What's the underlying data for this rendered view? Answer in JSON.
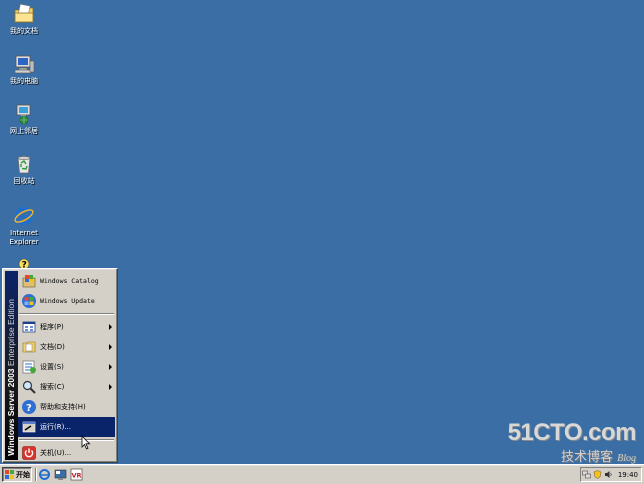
{
  "desktop": {
    "icons": [
      {
        "label": "我的文档",
        "icon": "my-documents-icon"
      },
      {
        "label": "我的电脑",
        "icon": "my-computer-icon"
      },
      {
        "label": "网上邻居",
        "icon": "network-places-icon"
      },
      {
        "label": "回收站",
        "icon": "recycle-bin-icon"
      },
      {
        "label": "Internet Explorer",
        "icon": "internet-explorer-icon"
      }
    ]
  },
  "start_menu": {
    "banner": {
      "brand": "Windows Server",
      "version": "2003",
      "edition": "Enterprise Edition"
    },
    "top_items": [
      {
        "label": "Windows Catalog",
        "icon": "windows-catalog-icon"
      },
      {
        "label": "Windows Update",
        "icon": "windows-update-icon"
      }
    ],
    "items": [
      {
        "label": "程序(P)",
        "icon": "programs-icon",
        "submenu": true
      },
      {
        "label": "文档(D)",
        "icon": "documents-icon",
        "submenu": true
      },
      {
        "label": "设置(S)",
        "icon": "settings-icon",
        "submenu": true
      },
      {
        "label": "搜索(C)",
        "icon": "search-icon",
        "submenu": true
      },
      {
        "label": "帮助和支持(H)",
        "icon": "help-icon",
        "submenu": false
      },
      {
        "label": "运行(R)...",
        "icon": "run-icon",
        "submenu": false,
        "highlighted": true
      }
    ],
    "shutdown": {
      "label": "关机(U)...",
      "icon": "shutdown-icon"
    }
  },
  "taskbar": {
    "start_label": "开始",
    "quick_launch": [
      "internet-explorer-icon",
      "show-desktop-icon",
      "vr-icon"
    ],
    "tray_icons": [
      "network-icon",
      "security-icon",
      "volume-icon"
    ],
    "clock": "19:40"
  },
  "watermark": {
    "logo": "51CTO.com",
    "subtitle": "技术博客",
    "blog": "Blog"
  },
  "colors": {
    "desktop": "#3a6ea5",
    "highlight": "#0a246a",
    "face": "#d4d0c8"
  }
}
